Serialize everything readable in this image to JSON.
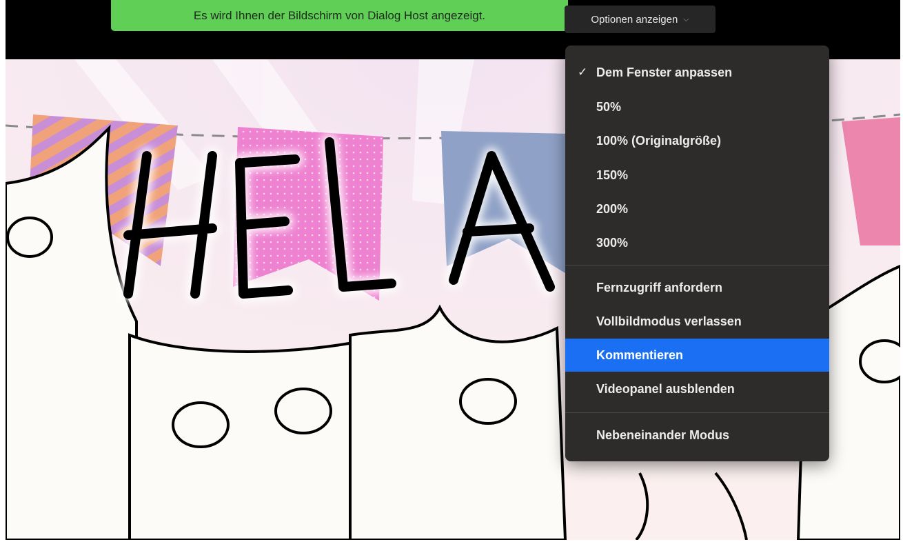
{
  "banner": {
    "text": "Es wird Ihnen der Bildschirm von Dialog Host angezeigt."
  },
  "options_button": {
    "label": "Optionen anzeigen",
    "icon": "chevron-down-icon"
  },
  "shared_screen": {
    "big_text": "HELA"
  },
  "menu": {
    "checked_index": 0,
    "highlighted": "Kommentieren",
    "accent_color": "#1a6ff3",
    "items": [
      {
        "label": "Dem Fenster anpassen"
      },
      {
        "label": "50%"
      },
      {
        "label": "100% (Originalgröße)"
      },
      {
        "label": "150%"
      },
      {
        "label": "200%"
      },
      {
        "label": "300%"
      },
      {
        "label": "Fernzugriff anfordern"
      },
      {
        "label": "Vollbildmodus verlassen"
      },
      {
        "label": "Kommentieren"
      },
      {
        "label": "Videopanel ausblenden"
      },
      {
        "label": "Nebeneinander Modus"
      }
    ]
  }
}
